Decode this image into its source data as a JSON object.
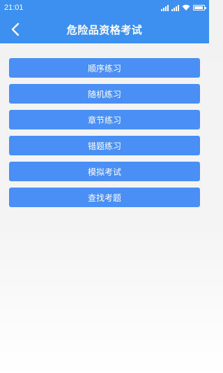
{
  "status_bar": {
    "time": "21:01",
    "icons": [
      "signal-icon",
      "signal-icon",
      "wifi-icon",
      "battery-icon"
    ]
  },
  "header": {
    "title": "危险品资格考试",
    "back_icon": "chevron-left-icon"
  },
  "menu": {
    "items": [
      {
        "label": "顺序练习"
      },
      {
        "label": "随机练习"
      },
      {
        "label": "章节练习"
      },
      {
        "label": "错题练习"
      },
      {
        "label": "模拟考试"
      },
      {
        "label": "查找考题"
      }
    ]
  },
  "colors": {
    "primary": "#3d8ff0",
    "button": "#4a8ff5",
    "background": "#f2f2f2"
  }
}
